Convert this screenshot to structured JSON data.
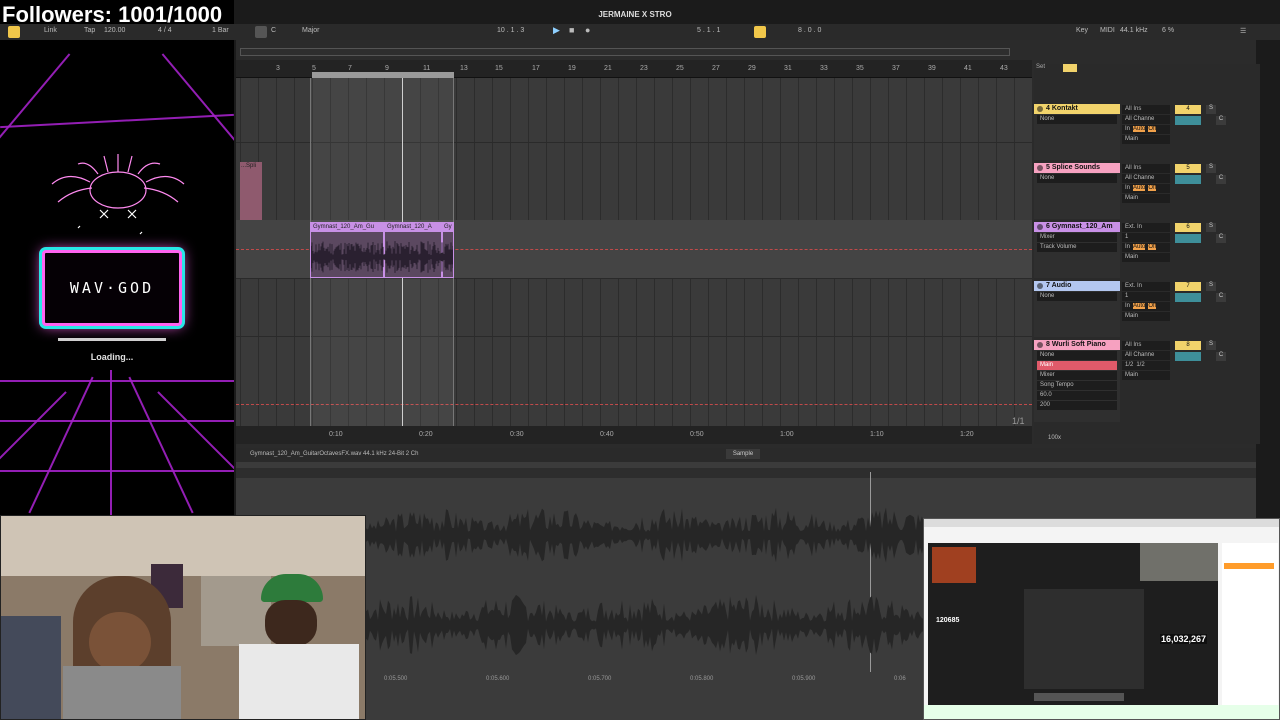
{
  "overlay": {
    "followers": "Followers: 1001/1000",
    "brand": "WAV·GOD",
    "loading": "Loading..."
  },
  "transport": {
    "title": "JERMAINE X STRO",
    "link": "Link",
    "tap": "Tap",
    "tempo": "120.00",
    "signature": "4 / 4",
    "quantize": "1 Bar",
    "key_root": "C",
    "scale": "Major",
    "position": "10 . 1 . 3",
    "loop_start": "5 . 1 . 1",
    "loop_length": "8 . 0 . 0",
    "key": "Key",
    "midi": "MIDI",
    "sample_rate": "44.1 kHz",
    "cpu": "6 %"
  },
  "arrangement": {
    "bar_numbers": [
      "3",
      "5",
      "7",
      "9",
      "11",
      "13",
      "15",
      "17",
      "19",
      "21",
      "23",
      "25",
      "27",
      "29",
      "31",
      "33",
      "35",
      "37",
      "39",
      "41",
      "43"
    ],
    "time_labels": [
      "0:10",
      "0:20",
      "0:30",
      "0:40",
      "0:50",
      "1:00",
      "1:10",
      "1:20"
    ],
    "clips": [
      {
        "name": "...Spli",
        "color": "#f6a1c0"
      },
      {
        "name": "Gymnast_120_Am_Gu",
        "color": "#c890e6"
      },
      {
        "name": "Gymnast_120_A",
        "color": "#c890e6"
      },
      {
        "name": "Gy",
        "color": "#c890e6"
      }
    ],
    "page_indicator": "1/1",
    "zoom": "100x",
    "set_label": "Set"
  },
  "tracks": [
    {
      "name": "4 Kontakt",
      "color": "#f1d36b",
      "device": "None",
      "input": "All Ins",
      "channel": "All Channe",
      "monitor": [
        "In",
        "Auto",
        "Off"
      ],
      "output": "Main",
      "number": "4",
      "s": "S",
      "c": "C",
      "extras": []
    },
    {
      "name": "5 Splice Sounds",
      "color": "#f6a1c0",
      "device": "None",
      "input": "All Ins",
      "channel": "All Channe",
      "monitor": [
        "In",
        "Auto",
        "Off"
      ],
      "output": "Main",
      "number": "5",
      "s": "S",
      "c": "C",
      "extras": []
    },
    {
      "name": "6 Gymnast_120_Am",
      "color": "#c890e6",
      "device": "Mixer",
      "input": "Ext. In",
      "channel": "1",
      "monitor": [
        "In",
        "Auto",
        "Off"
      ],
      "output": "Main",
      "number": "6",
      "s": "S",
      "c": "C",
      "extras": [
        "Track Volume"
      ]
    },
    {
      "name": "7 Audio",
      "color": "#b3c7f0",
      "device": "None",
      "input": "Ext. In",
      "channel": "1",
      "monitor": [
        "In",
        "Auto",
        "Off"
      ],
      "output": "Main",
      "number": "7",
      "s": "S",
      "c": "C",
      "extras": []
    },
    {
      "name": "8 Wurli Soft Piano",
      "color": "#f6a1c0",
      "device": "None",
      "input": "All Ins",
      "channel": "All Channe",
      "monitor": [
        "1/2",
        "1/2"
      ],
      "output": "Main",
      "number": "8",
      "s": "S",
      "c": "C",
      "extras": [
        "Main",
        "Mixer",
        "Song Tempo",
        "60.0",
        "200"
      ]
    }
  ],
  "clip_view": {
    "file_info": "Gymnast_120_Am_GuitarOctavesFX.wav  44.1 kHz  24-Bit  2 Ch",
    "tab": "Sample",
    "time_labels": [
      "0:05.500",
      "0:05.600",
      "0:05.700",
      "0:05.800",
      "0:05.900",
      "0:06"
    ]
  },
  "embed": {
    "viewers": "120685",
    "counter": "16,032,267"
  }
}
